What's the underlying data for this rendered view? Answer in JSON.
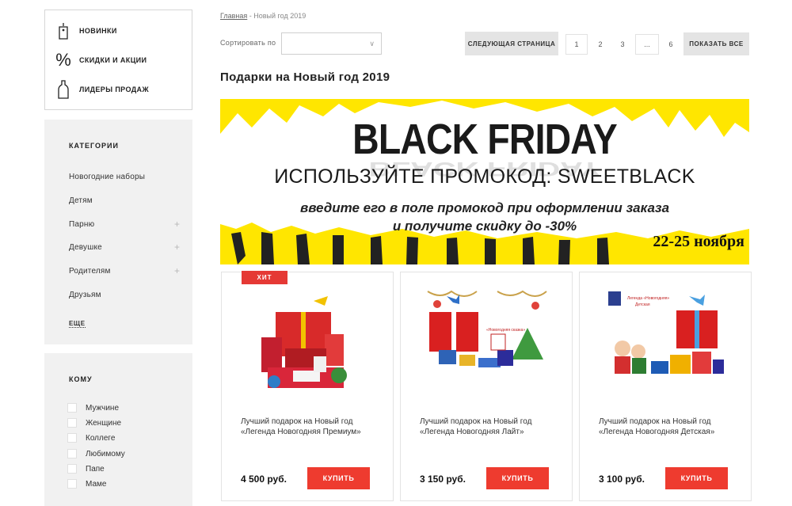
{
  "quick_links": [
    {
      "label": "НОВИНКИ",
      "icon": "tag-icon"
    },
    {
      "label": "СКИДКИ И АКЦИИ",
      "icon": "percent-icon"
    },
    {
      "label": "ЛИДЕРЫ ПРОДАЖ",
      "icon": "bottle-icon"
    }
  ],
  "categories": {
    "title": "КАТЕГОРИИ",
    "items": [
      {
        "label": "Новогодние наборы",
        "expandable": false
      },
      {
        "label": "Детям",
        "expandable": false
      },
      {
        "label": "Парню",
        "expandable": true
      },
      {
        "label": "Девушке",
        "expandable": true
      },
      {
        "label": "Родителям",
        "expandable": true
      },
      {
        "label": "Друзьям",
        "expandable": false
      }
    ],
    "more_label": "ЕЩЕ",
    "plus_glyph": "+"
  },
  "recipients": {
    "title": "КОМУ",
    "items": [
      "Мужчине",
      "Женщине",
      "Коллеге",
      "Любимому",
      "Папе",
      "Маме"
    ]
  },
  "breadcrumb": {
    "home": "Главная",
    "separator": " - ",
    "current": "Новый год 2019"
  },
  "sort": {
    "label": "Сортировать по",
    "value": ""
  },
  "pagination": {
    "next_label": "СЛЕДУЮЩАЯ СТРАНИЦА",
    "pages": [
      "1",
      "2",
      "3",
      "...",
      "6"
    ],
    "show_all_label": "ПОКАЗАТЬ ВСЕ"
  },
  "page_title": "Подарки на Новый год 2019",
  "banner": {
    "title": "BLACK FRIDAY",
    "promo": "ИСПОЛЬЗУЙТЕ ПРОМОКОД: SWEETBLACK",
    "line1": "введите его в поле промокод при оформлении заказа",
    "line2": "и получите скидку до -30%",
    "dates": "22-25 ноября",
    "accent_color": "#ffe600"
  },
  "products": [
    {
      "name": "Лучший подарок на Новый год «Легенда Новогодняя Премиум»",
      "price": "4 500 руб.",
      "buy_label": "КУПИТЬ",
      "badge": "ХИТ"
    },
    {
      "name": "Лучший подарок на Новый год «Легенда Новогодняя Лайт»",
      "price": "3 150 руб.",
      "buy_label": "КУПИТЬ",
      "badge": ""
    },
    {
      "name": "Лучший подарок на Новый год «Легенда Новогодняя Детская»",
      "price": "3 100 руб.",
      "buy_label": "КУПИТЬ",
      "badge": ""
    }
  ],
  "colors": {
    "buy": "#ee3b2f",
    "badge": "#e53935",
    "panel": "#f1f1f1"
  }
}
